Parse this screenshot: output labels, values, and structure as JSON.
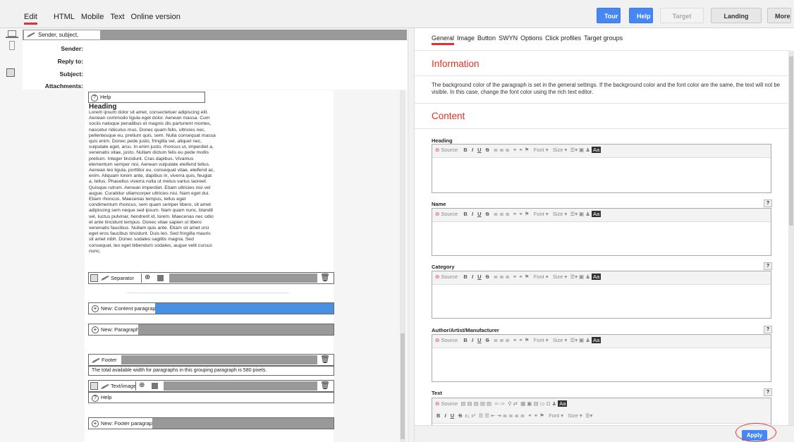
{
  "topbar": {
    "tabs": [
      "Edit",
      "HTML",
      "Mobile",
      "Text",
      "Online version"
    ],
    "buttons": {
      "tour": "Tour",
      "help": "Help",
      "target_group": "Target group",
      "landing_pages": "Landing pages",
      "more": "More"
    }
  },
  "header": {
    "section_label": "Sender, subject, attachments",
    "fields": [
      "Sender:",
      "Reply to:",
      "Subject:",
      "Attachments:"
    ]
  },
  "canvas": {
    "help_top": "Help",
    "heading": "Heading",
    "paragraph": "Lorem ipsum dolor sit amet, consectetuer adipiscing elit. Aenean commodo ligula eget dolor. Aenean massa. Cum sociis natoque penatibus et magnis dis parturient montes, nascetur ridiculus mus. Donec quam felis, ultricies nec, pellentesque eu, pretium quis, sem. Nulla consequat massa quis enim. Donec pede justo, fringilla vel, aliquet nec, vulputate eget, arcu. In enim justo, rhoncus ut, imperdiet a, venenatis vitae, justo. Nullam dictum felis eu pede mollis pretium. Integer tincidunt. Cras dapibus. Vivamus elementum semper nisi. Aenean vulputate eleifend tellus. Aenean leo ligula, porttitor eu, consequat vitae, eleifend ac, enim. Aliquam lorem ante, dapibus in, viverra quis, feugiat a, tellus. Phasellus viverra nulla ut metus varius laoreet. Quisque rutrum. Aenean imperdiet. Etiam ultricies nisi vel augue. Curabitur ullamcorper ultricies nisi. Nam eget dui. Etiam rhoncus. Maecenas tempus, tellus eget condimentum rhoncus, sem quam semper libero, sit amet adipiscing sem neque sed ipsum. Nam quam nunc, blandit vel, luctus pulvinar, hendrerit id, lorem. Maecenas nec odio et ante tincidunt tempus. Donec vitae sapien ut libero venenatis faucibus. Nullam quis ante. Etiam sit amet orci eget eros faucibus tincidunt. Duis leo. Sed fringilla mauris sit amet nibh. Donec sodales sagittis magna. Sed consequat, leo eget bibendum sodales, augue velit cursus nunc,",
    "separator": "Separator",
    "new_content_paragraph": "New: Content paragraph",
    "new_paragraph": "New: Paragraph",
    "footer": "Footer",
    "footer_note": "The total available width for paragraphs in this grouping paragraph is 580 pixels.",
    "text_image": "Text/image",
    "help_bottom": "Help",
    "new_footer_paragraph": "New: Footer paragraph"
  },
  "right": {
    "tabs": [
      "General",
      "Image",
      "Button",
      "SWYN",
      "Options",
      "Click profiles",
      "Target groups"
    ],
    "information_title": "Information",
    "information_text": "The background color of the paragraph is set in the general settings. If the background color and the font color are the same, the text will not be visible. In this case, change the font color using the rich text editor.",
    "content_title": "Content",
    "fields": [
      "Heading",
      "Name",
      "Category",
      "Author/Artist/Manufacturer",
      "Text"
    ],
    "toolbar": {
      "source": "Source",
      "font": "Font",
      "size": "Size"
    },
    "help_q": "?",
    "apply": "Apply"
  },
  "colors": {
    "accent_red": "#dd3333",
    "button_blue": "#4687f4",
    "selected_bar": "#4a90e2"
  }
}
